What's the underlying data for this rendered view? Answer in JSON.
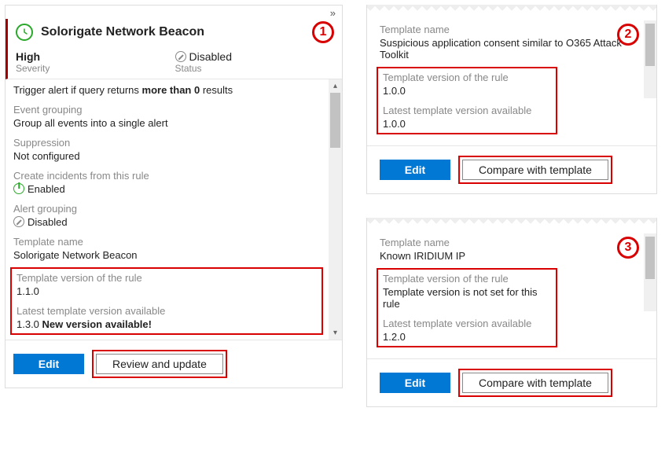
{
  "panel": {
    "title": "Solorigate Network Beacon",
    "badge": "1",
    "severity_label": "Severity",
    "severity_value": "High",
    "status_label": "Status",
    "status_value": "Disabled",
    "trigger_prefix": "Trigger alert if query returns ",
    "trigger_bold": "more than 0",
    "trigger_suffix": " results",
    "sections": {
      "event_grouping_label": "Event grouping",
      "event_grouping_value": "Group all events into a single alert",
      "suppression_label": "Suppression",
      "suppression_value": "Not configured",
      "create_incidents_label": "Create incidents from this rule",
      "create_incidents_value": "Enabled",
      "alert_grouping_label": "Alert grouping",
      "alert_grouping_value": "Disabled",
      "template_name_label": "Template name",
      "template_name_value": "Solorigate Network Beacon",
      "version_rule_label": "Template version of the rule",
      "version_rule_value": "1.1.0",
      "version_latest_label": "Latest template version available",
      "version_latest_value": "1.3.0 ",
      "version_latest_new": "New version available!"
    },
    "footer": {
      "edit_label": "Edit",
      "review_label": "Review and update"
    }
  },
  "card2": {
    "badge": "2",
    "template_name_label": "Template name",
    "template_name_value": "Suspicious application consent similar to O365 Attack Toolkit",
    "version_rule_label": "Template version of the rule",
    "version_rule_value": "1.0.0",
    "version_latest_label": "Latest template version available",
    "version_latest_value": "1.0.0",
    "edit_label": "Edit",
    "compare_label": "Compare with template"
  },
  "card3": {
    "badge": "3",
    "template_name_label": "Template name",
    "template_name_value": "Known IRIDIUM IP",
    "version_rule_label": "Template version of the rule",
    "version_rule_value": "Template version is not set for this rule",
    "version_latest_label": "Latest template version available",
    "version_latest_value": "1.2.0",
    "edit_label": "Edit",
    "compare_label": "Compare with template"
  }
}
